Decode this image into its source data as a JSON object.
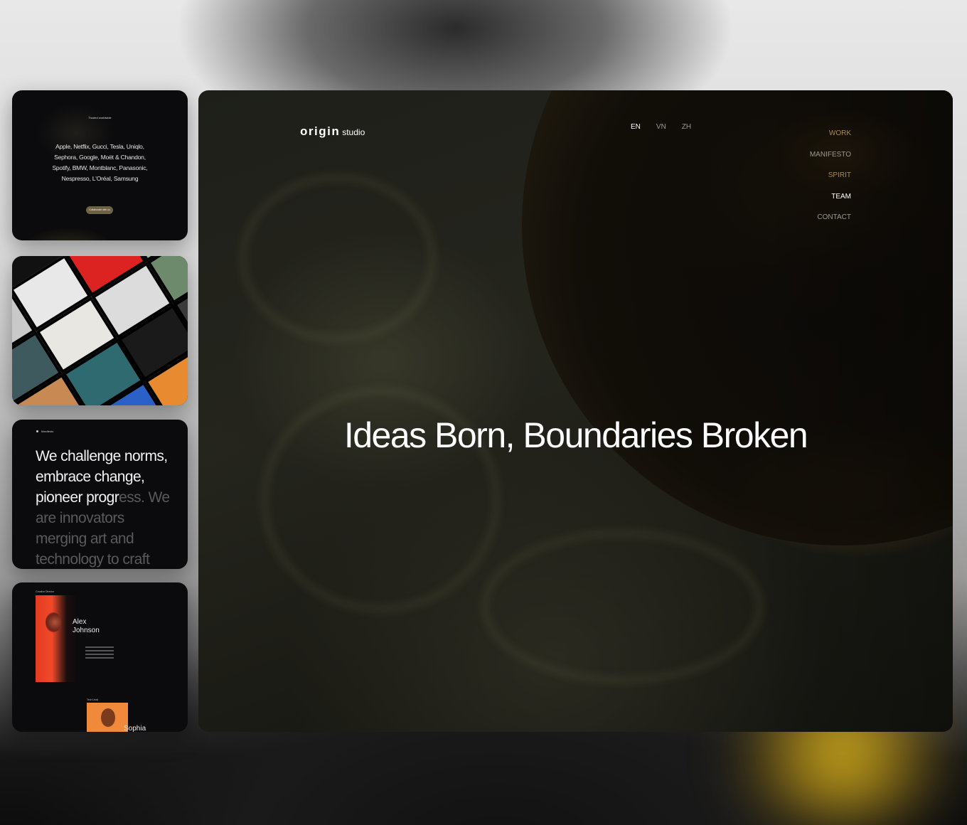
{
  "clients_card": {
    "heading": "Trusted worldwide",
    "list": "Apple, Netflix, Gucci, Tesla, Uniqlo, Sephora, Google, Moët & Chandon, Spotify, BMW, Montblanc, Panasonic, Nespresso, L'Oréal, Samsung",
    "button": "Collaborate with us"
  },
  "manifesto_card": {
    "label": "Manifesto",
    "text_bright": "We challenge norms, embrace change, pioneer progr",
    "text_dim": "ess. We are innovators merging art and technology to craft"
  },
  "team_card": {
    "role_1": "Creative Director",
    "name_1": "Alex Johnson",
    "role_2": "Tech Lead",
    "name_2": "Sophia"
  },
  "main": {
    "logo_bold": "origin",
    "logo_light": "studio",
    "languages": [
      {
        "label": "EN",
        "active": true
      },
      {
        "label": "VN",
        "active": false
      },
      {
        "label": "ZH",
        "active": false
      }
    ],
    "nav": [
      "WORK",
      "MANIFESTO",
      "SPIRIT",
      "TEAM",
      "CONTACT"
    ],
    "headline": "Ideas Born, Boundaries Broken"
  },
  "colors": {
    "accent_gold": "#a88c4e",
    "button_bg": "#6d6342",
    "screen_bg": "#1e1f19"
  }
}
